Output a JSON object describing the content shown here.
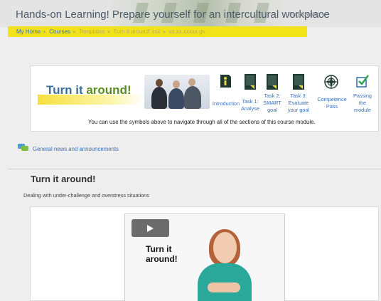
{
  "header": {
    "site_title": "Hands-on Learning! Prepare yourself for an intercultural workplace",
    "language": "English (en)"
  },
  "breadcrumb": {
    "items": [
      "My Home",
      "Courses",
      "Templates",
      "Turn it around! xxx",
      "xx.xx.xxxxx gk"
    ],
    "separator": "▸"
  },
  "module_nav": {
    "banner_title_part1": "Turn it ",
    "banner_title_part2": "around!",
    "items": [
      {
        "label": "Introduction",
        "icon": "info-person-icon"
      },
      {
        "label": "Task 1: Analyse",
        "icon": "book-icon"
      },
      {
        "label": "Task 2: SMART goal",
        "icon": "book-icon"
      },
      {
        "label": "Task 3: Evaluate your goal",
        "icon": "book-icon"
      },
      {
        "label": "Competence Pass",
        "icon": "compass-icon"
      },
      {
        "label": "Passing the module",
        "icon": "checkbox-icon"
      }
    ],
    "nav_note": "You can use the symbols above to navigate through all of the sections of this course module."
  },
  "news": {
    "label": "General news and announcements",
    "icon": "forum-icon"
  },
  "section": {
    "title": "Turn it around!",
    "subtitle": "Dealing with under-challenge and overstress situations"
  },
  "video": {
    "title_line1": "Turn it",
    "title_line2": "around!",
    "play_icon": "play-icon"
  },
  "colors": {
    "breadcrumb_bg": "#f2e21a",
    "link": "#3b6fb6",
    "banner_blue": "#3b6e9c",
    "banner_green": "#5a8c1f",
    "icon_dark": "#1f3a33",
    "icon_yellow": "#e8d64a"
  }
}
